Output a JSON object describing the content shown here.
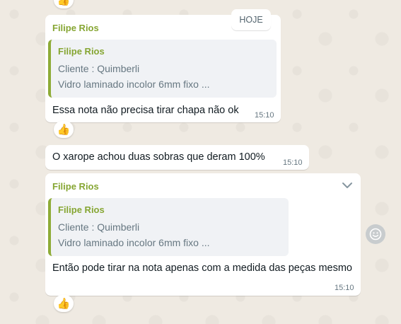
{
  "date_divider": "HOJE",
  "messages": [
    {
      "sender": "Filipe Rios",
      "quote": {
        "sender": "Filipe Rios",
        "lines": [
          "Cliente : Quimberli",
          "Vidro laminado incolor 6mm fixo ..."
        ]
      },
      "text": "Essa nota não precisa tirar chapa não ok",
      "time": "15:10",
      "reaction": "👍"
    },
    {
      "text": "O xarope achou duas sobras que deram 100%",
      "time": "15:10"
    },
    {
      "sender": "Filipe Rios",
      "quote": {
        "sender": "Filipe Rios",
        "lines": [
          "Cliente : Quimberli",
          "Vidro laminado incolor 6mm fixo ..."
        ]
      },
      "text": "Então pode tirar na nota apenas com a medida das peças mesmo",
      "time": "15:10",
      "reaction": "👍",
      "menu_icon": "chevron-down-icon"
    }
  ],
  "top_reaction": "👍",
  "emoji_button_icon": "smiley-icon"
}
